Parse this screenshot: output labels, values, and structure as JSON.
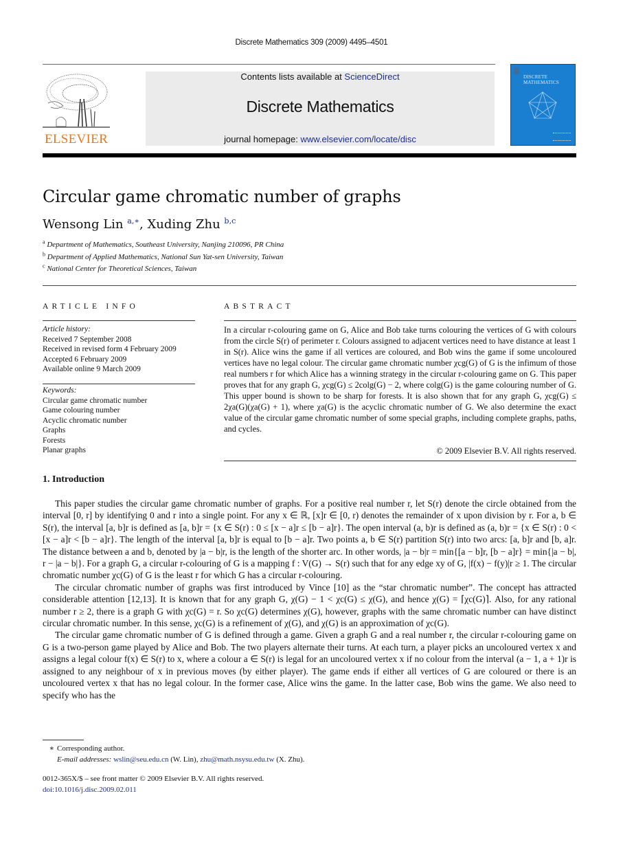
{
  "header": {
    "journal_ref": "Discrete Mathematics 309 (2009) 4495–4501",
    "publisher_logo_text": "ELSEVIER",
    "contents_prefix": "Contents lists available at ",
    "contents_link": "ScienceDirect",
    "journal_title": "Discrete Mathematics",
    "homepage_prefix": "journal homepage: ",
    "homepage_link": "www.elsevier.com/locate/disc",
    "cover_title_line1": "DISCRETE",
    "cover_title_line2": "MATHEMATICS",
    "colors": {
      "publisher_orange": "#e8781e",
      "link_blue": "#1d2f8f",
      "cover_blue": "#1a7fd0",
      "banner_gray": "#ebebeb"
    }
  },
  "article": {
    "title": "Circular game chromatic number of graphs",
    "authors": [
      {
        "name": "Wensong Lin",
        "marks": "a,∗"
      },
      {
        "name": "Xuding Zhu",
        "marks": "b,c"
      }
    ],
    "author_separator": ", ",
    "affiliations": [
      {
        "mark": "a",
        "text": "Department of Mathematics, Southeast University, Nanjing 210096, PR China"
      },
      {
        "mark": "b",
        "text": "Department of Applied Mathematics, National Sun Yat-sen University, Taiwan"
      },
      {
        "mark": "c",
        "text": "National Center for Theoretical Sciences, Taiwan"
      }
    ]
  },
  "article_info": {
    "heading": "ARTICLE INFO",
    "history_label": "Article history:",
    "history": [
      "Received 7 September 2008",
      "Received in revised form 4 February 2009",
      "Accepted 6 February 2009",
      "Available online 9 March 2009"
    ],
    "keywords_label": "Keywords:",
    "keywords": [
      "Circular game chromatic number",
      "Game colouring number",
      "Acyclic chromatic number",
      "Graphs",
      "Forests",
      "Planar graphs"
    ]
  },
  "abstract": {
    "heading": "ABSTRACT",
    "text": "In a circular r-colouring game on G, Alice and Bob take turns colouring the vertices of G with colours from the circle S(r) of perimeter r. Colours assigned to adjacent vertices need to have distance at least 1 in S(r). Alice wins the game if all vertices are coloured, and Bob wins the game if some uncoloured vertices have no legal colour. The circular game chromatic number χcg(G) of G is the infimum of those real numbers r for which Alice has a winning strategy in the circular r-colouring game on G. This paper proves that for any graph G, χcg(G) ≤ 2colg(G) − 2, where colg(G) is the game colouring number of G. This upper bound is shown to be sharp for forests. It is also shown that for any graph G, χcg(G) ≤ 2χa(G)(χa(G) + 1), where χa(G) is the acyclic chromatic number of G. We also determine the exact value of the circular game chromatic number of some special graphs, including complete graphs, paths, and cycles.",
    "copyright": "© 2009 Elsevier B.V. All rights reserved."
  },
  "introduction": {
    "heading": "1.  Introduction",
    "paragraphs": [
      "This paper studies the circular game chromatic number of graphs. For a positive real number r, let S(r) denote the circle obtained from the interval [0, r] by identifying 0 and r into a single point. For any x ∈ ℝ, [x]r ∈ [0, r) denotes the remainder of x upon division by r. For a, b ∈ S(r), the interval [a, b]r is defined as [a, b]r = {x ∈ S(r) : 0 ≤ [x − a]r ≤ [b − a]r}. The open interval (a, b)r is defined as (a, b)r = {x ∈ S(r) : 0 < [x − a]r < [b − a]r}. The length of the interval [a, b]r is equal to [b − a]r. Two points a, b ∈ S(r) partition S(r) into two arcs: [a, b]r and [b, a]r. The distance between a and b, denoted by |a − b|r, is the length of the shorter arc. In other words, |a − b|r = min{[a − b]r, [b − a]r} = min{|a − b|, r − |a − b|}. For a graph G, a circular r-colouring of G is a mapping f : V(G) → S(r) such that for any edge xy of G, |f(x) − f(y)|r ≥ 1. The circular chromatic number χc(G) of G is the least r for which G has a circular r-colouring.",
      "The circular chromatic number of graphs was first introduced by Vince [10] as the “star chromatic number”. The concept has attracted considerable attention [12,13]. It is known that for any graph G, χ(G) − 1 < χc(G) ≤ χ(G), and hence χ(G) = ⌈χc(G)⌉. Also, for any rational number r ≥ 2, there is a graph G with χc(G) = r. So χc(G) determines χ(G), however, graphs with the same chromatic number can have distinct circular chromatic number. In this sense, χc(G) is a refinement of χ(G), and χ(G) is an approximation of χc(G).",
      "The circular game chromatic number of G is defined through a game. Given a graph G and a real number r, the circular r-colouring game on G is a two-person game played by Alice and Bob. The two players alternate their turns. At each turn, a player picks an uncoloured vertex x and assigns a legal colour f(x) ∈ S(r) to x, where a colour a ∈ S(r) is legal for an uncoloured vertex x if no colour from the interval (a − 1, a + 1)r is assigned to any neighbour of x in previous moves (by either player). The game ends if either all vertices of G are coloured or there is an uncoloured vertex x that has no legal colour. In the former case, Alice wins the game. In the latter case, Bob wins the game. We also need to specify who has the"
    ],
    "citations": [
      "[10]",
      "[12,13]"
    ]
  },
  "footnotes": {
    "star": "∗",
    "corresponding": "Corresponding author.",
    "email_label": "E-mail addresses:",
    "emails": [
      {
        "address": "wslin@seu.edu.cn",
        "owner": "(W. Lin)"
      },
      {
        "address": "zhu@math.nsysu.edu.tw",
        "owner": "(X. Zhu)."
      }
    ],
    "front_matter": "0012-365X/$ – see front matter © 2009 Elsevier B.V. All rights reserved.",
    "doi": "doi:10.1016/j.disc.2009.02.011"
  }
}
